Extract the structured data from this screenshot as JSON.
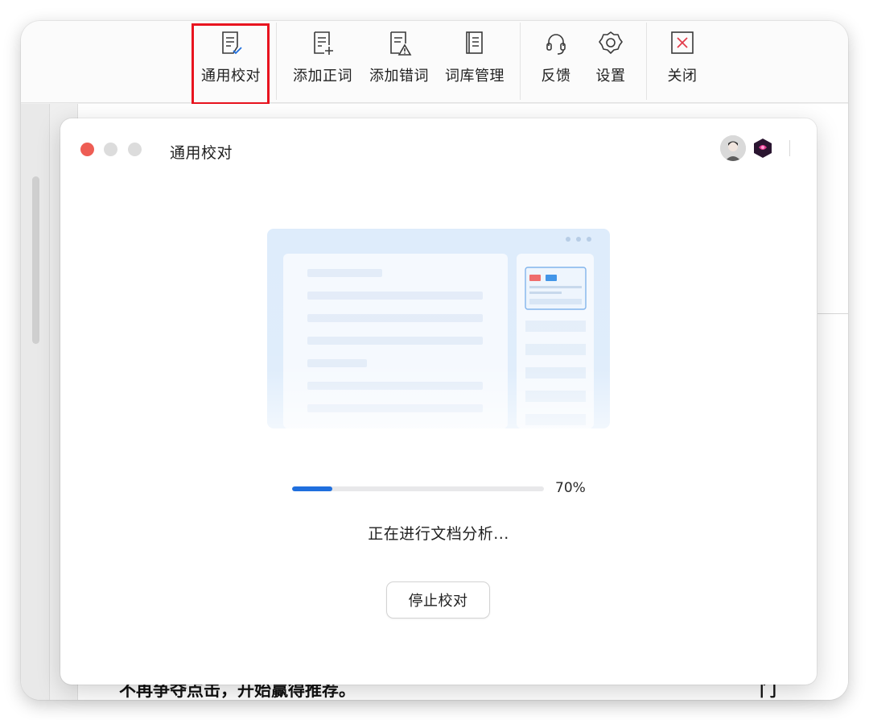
{
  "toolbar": {
    "items": [
      {
        "label": "通用校对",
        "icon": "document-check-icon"
      },
      {
        "label": "添加正词",
        "icon": "document-add-icon"
      },
      {
        "label": "添加错词",
        "icon": "document-warning-icon"
      },
      {
        "label": "词库管理",
        "icon": "book-icon"
      },
      {
        "label": "反馈",
        "icon": "headset-icon"
      },
      {
        "label": "设置",
        "icon": "gear-icon"
      },
      {
        "label": "关闭",
        "icon": "close-box-icon"
      }
    ],
    "highlight_color": "#e8141f"
  },
  "document": {
    "text_line": "不再争夺点击，开始赢得推荐。",
    "text_right": "门"
  },
  "dialog": {
    "title": "通用校对",
    "progress": {
      "value": 0.7,
      "label": "70%"
    },
    "status": "正在进行文档分析...",
    "stop_button": "停止校对",
    "accent_color": "#1f6fde"
  }
}
